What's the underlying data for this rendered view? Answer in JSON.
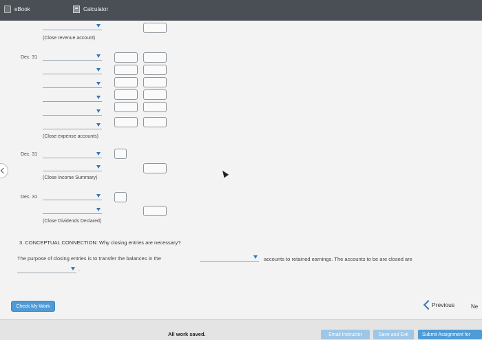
{
  "topbar": {
    "ebook_label": "eBook",
    "calculator_label": "Calculator"
  },
  "entries": {
    "close_revenue_label": "(Close revenue account)",
    "dec31_a": "Dec. 31",
    "close_expense_label": "(Close expense accounts)",
    "dec31_b": "Dec. 31",
    "close_income_summary_label": "(Close Income Summary)",
    "dec31_c": "Dec. 31",
    "close_dividends_label": "(Close Dividends Declared)"
  },
  "question": {
    "number_text": "3. CONCEPTUAL CONNECTION: Why closing entries are necessary?",
    "purpose_text": "The purpose of closing entries is to transfer the balances in the",
    "after_text": "accounts to retained earnings. The accounts to be are closed are",
    "trailing_period": "."
  },
  "actions": {
    "check_my_work": "Check My Work",
    "previous": "Previous",
    "next": "Ne"
  },
  "footer": {
    "status": "All work saved.",
    "email_instructor": "Email Instructor",
    "save_and_exit": "Save and Exit",
    "submit_assignment": "Submit Assignment for"
  },
  "colors": {
    "accent": "#3b74b8",
    "button": "#4f9bd6",
    "topbar": "#4a4e55"
  },
  "icons": [
    "book-icon",
    "calculator-icon",
    "dropdown-arrow-icon",
    "chevron-left-icon"
  ]
}
